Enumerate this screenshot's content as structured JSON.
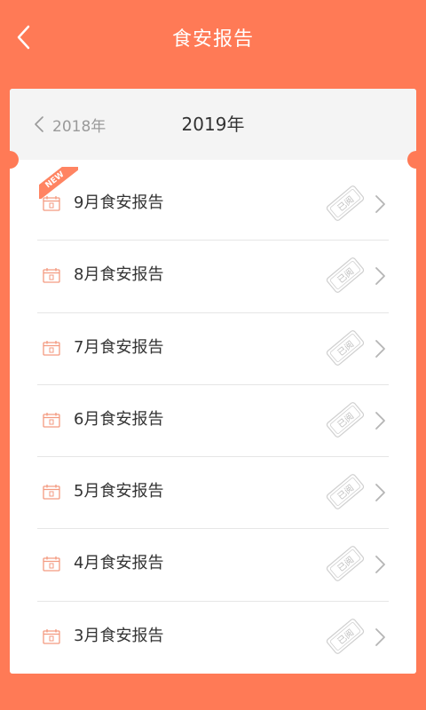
{
  "header": {
    "title": "食安报告",
    "back_icon": "chevron-left-icon"
  },
  "year_selector": {
    "previous_year": "2018年",
    "current_year": "2019年"
  },
  "colors": {
    "brand": "#FF7A56",
    "text": "#333333",
    "muted": "#9A9A9A",
    "divider": "#E6E6E6",
    "stamp": "#CFCFCF"
  },
  "reports": [
    {
      "label": "9月食安报告",
      "is_new": true,
      "new_tag": "NEW",
      "stamp": "已阅"
    },
    {
      "label": "8月食安报告",
      "is_new": false,
      "stamp": "已阅"
    },
    {
      "label": "7月食安报告",
      "is_new": false,
      "stamp": "已阅"
    },
    {
      "label": "6月食安报告",
      "is_new": false,
      "stamp": "已阅"
    },
    {
      "label": "5月食安报告",
      "is_new": false,
      "stamp": "已阅"
    },
    {
      "label": "4月食安报告",
      "is_new": false,
      "stamp": "已阅"
    },
    {
      "label": "3月食安报告",
      "is_new": false,
      "stamp": "已阅"
    }
  ]
}
